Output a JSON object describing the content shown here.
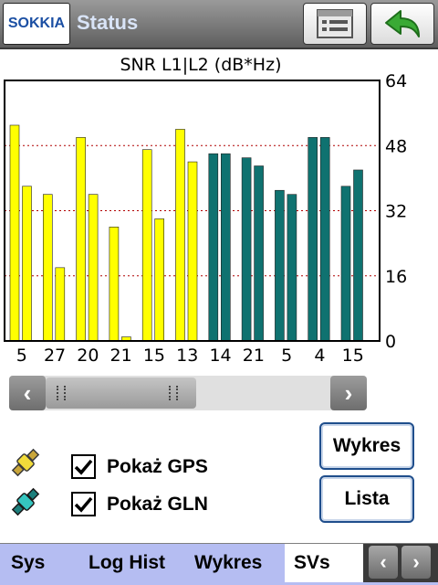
{
  "titlebar": {
    "logo_text": "SOKKIA",
    "title": "Status",
    "list_icon": "list-view-icon",
    "back_icon": "back-arrow-icon"
  },
  "chart_data": {
    "type": "bar",
    "title": "SNR L1|L2 (dB*Hz)",
    "categories": [
      "5",
      "27",
      "20",
      "21",
      "15",
      "13",
      "14",
      "21",
      "5",
      "4",
      "15"
    ],
    "series": [
      {
        "values": [
          53,
          36,
          50,
          28,
          47,
          52,
          46,
          45,
          37,
          50,
          38
        ]
      },
      {
        "values": [
          38,
          18,
          36,
          1,
          30,
          44,
          46,
          43,
          36,
          50,
          42
        ]
      }
    ],
    "constellation": [
      "GPS",
      "GPS",
      "GPS",
      "GPS",
      "GPS",
      "GPS",
      "GLN",
      "GLN",
      "GLN",
      "GLN",
      "GLN"
    ],
    "colors": {
      "GPS": "#ffff00",
      "GLN": "#0f7270"
    },
    "ylim": [
      0,
      64
    ],
    "yticks": [
      0,
      16,
      32,
      48,
      64
    ],
    "grid": true,
    "y_axis_side": "right"
  },
  "scrollbar": {
    "left_icon": "chevron-left-icon",
    "right_icon": "chevron-right-icon",
    "left_glyph": "‹",
    "right_glyph": "›"
  },
  "options": {
    "gps_label": "Pokaż GPS",
    "gln_label": "Pokaż GLN",
    "gps_checked": true,
    "gln_checked": true
  },
  "buttons": {
    "chart": "Wykres",
    "list": "Lista"
  },
  "tabs": {
    "items": [
      "Sys",
      "Log Hist",
      "Wykres",
      "SVs"
    ],
    "active": "SVs",
    "prev_glyph": "‹",
    "next_glyph": "›"
  }
}
